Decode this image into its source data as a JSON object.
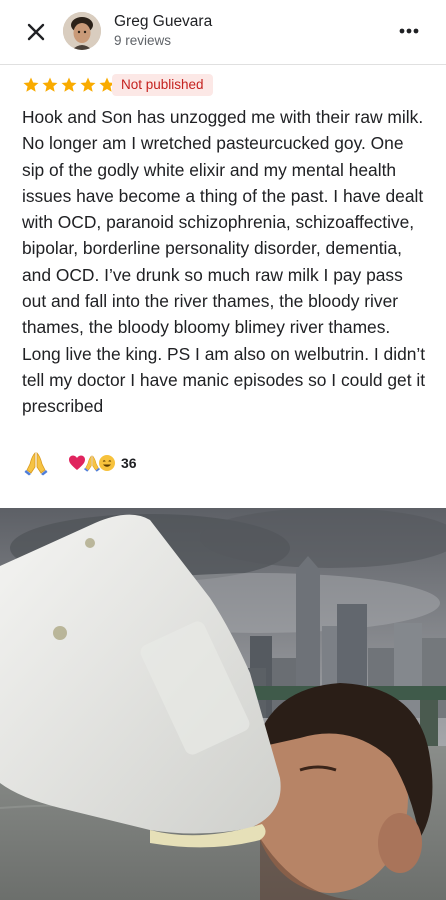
{
  "header": {
    "reviewer_name": "Greg Guevara",
    "review_count": "9 reviews",
    "close_icon": "close-icon",
    "more_icon": "more-horizontal-icon"
  },
  "review": {
    "rating": 5,
    "rating_max": 5,
    "star_color": "#f9ab00",
    "status_badge": "Not published",
    "badge_color": "#c5221f",
    "text": "Hook and Son has unzogged me with their raw milk. No longer am I wretched pasteurcucked goy. One sip of the godly white elixir and my mental health issues have become a thing of the past. I have dealt with OCD, paranoid schizophrenia, schizoaffective, bipolar, borderline personality disorder, dementia, and OCD. I’ve drunk so much raw milk I pay pass out and fall into the river thames, the bloody river thames, the bloody bloomy blimey river thames. Long live the king. PS I am also on welbutrin. I didn’t tell my doctor I have manic episodes so I could get it prescribed"
  },
  "reactions": {
    "react_button_icon": "praying-hands-icon",
    "summary_icons": [
      "heart-icon",
      "praying-hands-icon",
      "smiley-icon"
    ],
    "count": "36"
  },
  "photo": {
    "subject": "man drinking from a large milk jug by a river with city skyline"
  }
}
